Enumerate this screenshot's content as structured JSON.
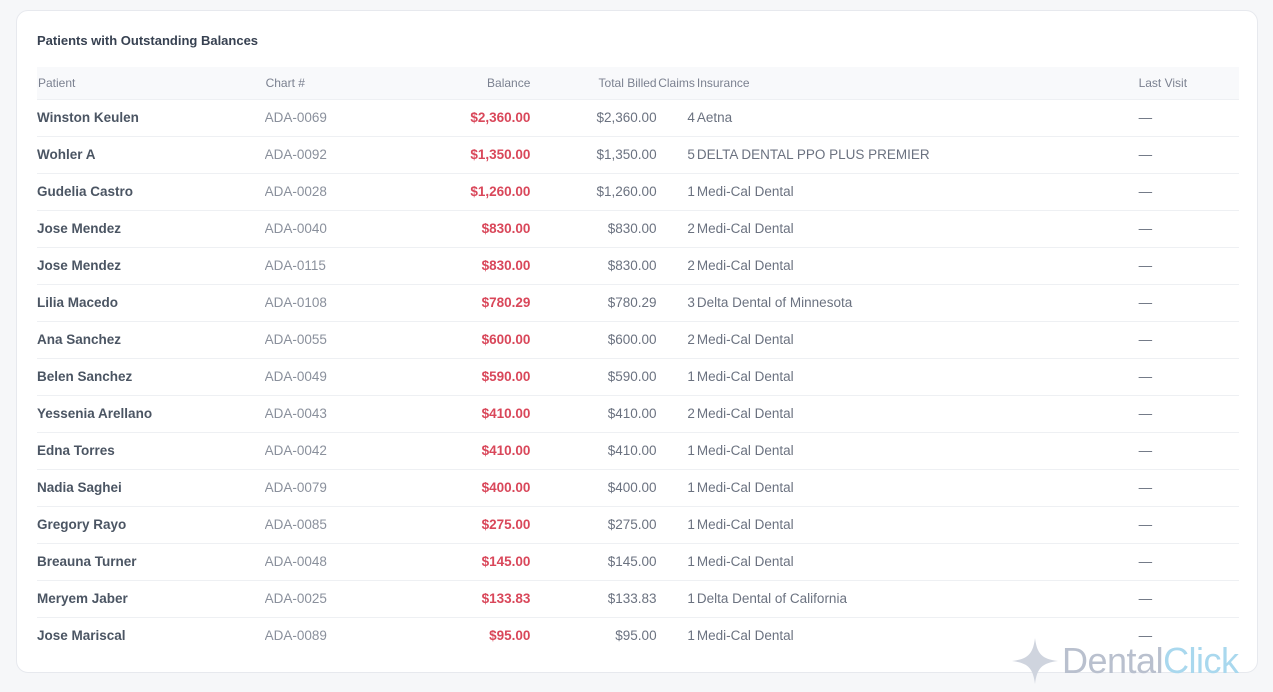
{
  "panel": {
    "title": "Patients with Outstanding Balances"
  },
  "columns": {
    "patient": "Patient",
    "chart": "Chart #",
    "balance": "Balance",
    "billed": "Total Billed",
    "claims": "Claims",
    "insurance": "Insurance",
    "last_visit": "Last Visit"
  },
  "rows": [
    {
      "patient": "Winston Keulen",
      "chart": "ADA-0069",
      "balance": "$2,360.00",
      "billed": "$2,360.00",
      "claims": "4",
      "insurance": "Aetna",
      "last_visit": "—"
    },
    {
      "patient": "Wohler A",
      "chart": "ADA-0092",
      "balance": "$1,350.00",
      "billed": "$1,350.00",
      "claims": "5",
      "insurance": "DELTA DENTAL PPO PLUS PREMIER",
      "last_visit": "—"
    },
    {
      "patient": "Gudelia Castro",
      "chart": "ADA-0028",
      "balance": "$1,260.00",
      "billed": "$1,260.00",
      "claims": "1",
      "insurance": "Medi-Cal Dental",
      "last_visit": "—"
    },
    {
      "patient": "Jose Mendez",
      "chart": "ADA-0040",
      "balance": "$830.00",
      "billed": "$830.00",
      "claims": "2",
      "insurance": "Medi-Cal Dental",
      "last_visit": "—"
    },
    {
      "patient": "Jose Mendez",
      "chart": "ADA-0115",
      "balance": "$830.00",
      "billed": "$830.00",
      "claims": "2",
      "insurance": "Medi-Cal Dental",
      "last_visit": "—"
    },
    {
      "patient": "Lilia Macedo",
      "chart": "ADA-0108",
      "balance": "$780.29",
      "billed": "$780.29",
      "claims": "3",
      "insurance": "Delta Dental of Minnesota",
      "last_visit": "—"
    },
    {
      "patient": "Ana Sanchez",
      "chart": "ADA-0055",
      "balance": "$600.00",
      "billed": "$600.00",
      "claims": "2",
      "insurance": "Medi-Cal Dental",
      "last_visit": "—"
    },
    {
      "patient": "Belen Sanchez",
      "chart": "ADA-0049",
      "balance": "$590.00",
      "billed": "$590.00",
      "claims": "1",
      "insurance": "Medi-Cal Dental",
      "last_visit": "—"
    },
    {
      "patient": "Yessenia Arellano",
      "chart": "ADA-0043",
      "balance": "$410.00",
      "billed": "$410.00",
      "claims": "2",
      "insurance": "Medi-Cal Dental",
      "last_visit": "—"
    },
    {
      "patient": "Edna Torres",
      "chart": "ADA-0042",
      "balance": "$410.00",
      "billed": "$410.00",
      "claims": "1",
      "insurance": "Medi-Cal Dental",
      "last_visit": "—"
    },
    {
      "patient": "Nadia Saghei",
      "chart": "ADA-0079",
      "balance": "$400.00",
      "billed": "$400.00",
      "claims": "1",
      "insurance": "Medi-Cal Dental",
      "last_visit": "—"
    },
    {
      "patient": "Gregory Rayo",
      "chart": "ADA-0085",
      "balance": "$275.00",
      "billed": "$275.00",
      "claims": "1",
      "insurance": "Medi-Cal Dental",
      "last_visit": "—"
    },
    {
      "patient": "Breauna Turner",
      "chart": "ADA-0048",
      "balance": "$145.00",
      "billed": "$145.00",
      "claims": "1",
      "insurance": "Medi-Cal Dental",
      "last_visit": "—"
    },
    {
      "patient": "Meryem Jaber",
      "chart": "ADA-0025",
      "balance": "$133.83",
      "billed": "$133.83",
      "claims": "1",
      "insurance": "Delta Dental of California",
      "last_visit": "—"
    },
    {
      "patient": "Jose Mariscal",
      "chart": "ADA-0089",
      "balance": "$95.00",
      "billed": "$95.00",
      "claims": "1",
      "insurance": "Medi-Cal Dental",
      "last_visit": "—"
    }
  ],
  "watermark": {
    "part1": "Dental",
    "part2": "Click",
    "icon": "sparkle-icon",
    "colors": {
      "part1": "#b9c0ce",
      "part2": "#a9d8ee",
      "balance": "#d9475a"
    }
  }
}
